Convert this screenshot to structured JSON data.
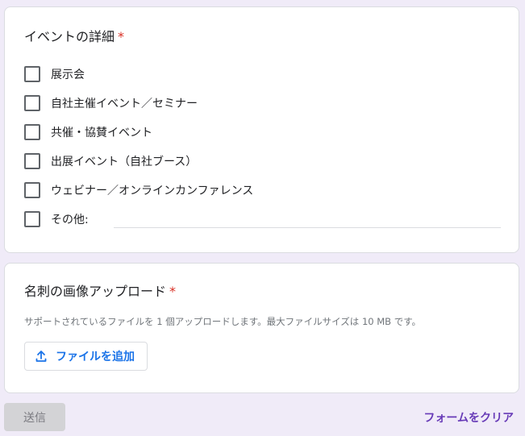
{
  "event_section": {
    "title": "イベントの詳細",
    "required_mark": "*",
    "options": [
      {
        "label": "展示会"
      },
      {
        "label": "自社主催イベント／セミナー"
      },
      {
        "label": "共催・協賛イベント"
      },
      {
        "label": "出展イベント（自社ブース）"
      },
      {
        "label": "ウェビナー／オンラインカンファレンス"
      },
      {
        "label": "その他:"
      }
    ]
  },
  "upload_section": {
    "title": "名刺の画像アップロード",
    "required_mark": "*",
    "hint": "サポートされているファイルを 1 個アップロードします。最大ファイルサイズは 10 MB です。",
    "add_file_label": "ファイルを追加"
  },
  "footer": {
    "submit_label": "送信",
    "clear_label": "フォームをクリア"
  },
  "colors": {
    "background": "#f0ebf8",
    "accent": "#673ab7",
    "link_blue": "#1a73e8",
    "required": "#d93025"
  },
  "icons": {
    "upload": "upload-icon"
  }
}
